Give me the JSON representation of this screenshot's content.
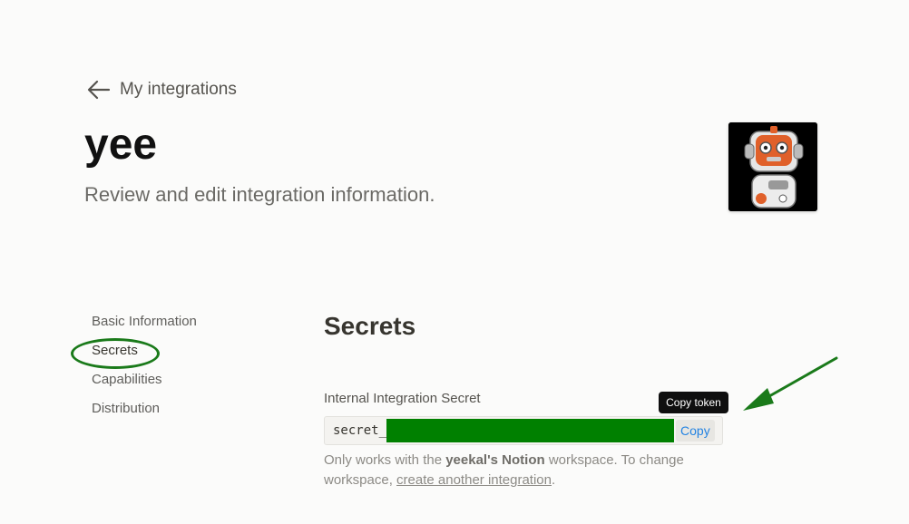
{
  "header": {
    "back_label": "My integrations",
    "title": "yee",
    "subtitle": "Review and edit integration information."
  },
  "sidenav": {
    "items": [
      {
        "label": "Basic Information"
      },
      {
        "label": "Secrets",
        "active": true
      },
      {
        "label": "Capabilities"
      },
      {
        "label": "Distribution"
      }
    ]
  },
  "secrets": {
    "section_title": "Secrets",
    "field_label": "Internal Integration Secret",
    "secret_prefix": "secret_",
    "copy_label": "Copy",
    "tooltip": "Copy token",
    "help": {
      "before": "Only works with the ",
      "workspace": "yeekal's Notion",
      "middle": " workspace. To change workspace, ",
      "link": "create another integration",
      "after": "."
    }
  },
  "colors": {
    "annotation_green": "#1a7a1a",
    "redaction_green": "#008000",
    "link_blue": "#2383e2"
  }
}
